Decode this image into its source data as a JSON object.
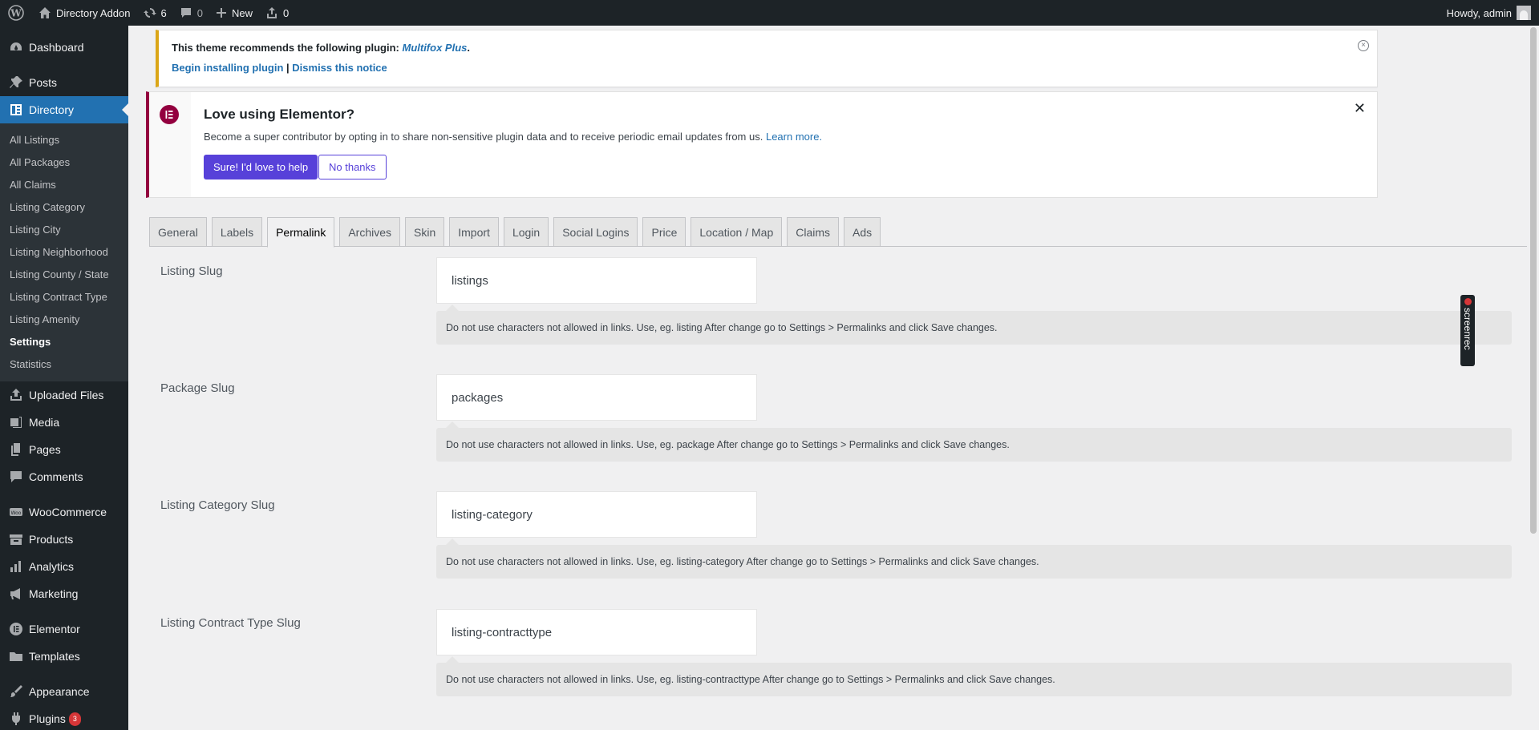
{
  "adminbar": {
    "site_name": "Directory Addon",
    "updates_count": "6",
    "comments_count": "0",
    "new_label": "New",
    "uploads_count": "0",
    "howdy": "Howdy, admin"
  },
  "sidebar": {
    "dashboard": "Dashboard",
    "posts": "Posts",
    "directory": "Directory",
    "submenu": [
      "All Listings",
      "All Packages",
      "All Claims",
      "Listing Category",
      "Listing City",
      "Listing Neighborhood",
      "Listing County / State",
      "Listing Contract Type",
      "Listing Amenity",
      "Settings",
      "Statistics"
    ],
    "uploaded_files": "Uploaded Files",
    "media": "Media",
    "pages": "Pages",
    "comments": "Comments",
    "woocommerce": "WooCommerce",
    "products": "Products",
    "analytics": "Analytics",
    "marketing": "Marketing",
    "elementor": "Elementor",
    "templates": "Templates",
    "appearance": "Appearance",
    "plugins": "Plugins",
    "plugins_badge": "3"
  },
  "notice_tgm": {
    "text": "This theme recommends the following plugin:",
    "plugin": "Multifox Plus",
    "period": ".",
    "begin": "Begin installing plugin",
    "divider": "|",
    "dismiss": "Dismiss this notice"
  },
  "notice_elementor": {
    "title": "Love using Elementor?",
    "text": "Become a super contributor by opting in to share non-sensitive plugin data and to receive periodic email updates from us.",
    "learn_more": "Learn more.",
    "yes": "Sure! I'd love to help",
    "no": "No thanks"
  },
  "tabs": [
    "General",
    "Labels",
    "Permalink",
    "Archives",
    "Skin",
    "Import",
    "Login",
    "Social Logins",
    "Price",
    "Location / Map",
    "Claims",
    "Ads"
  ],
  "active_tab": "Permalink",
  "fields": [
    {
      "label": "Listing Slug",
      "value": "listings",
      "desc": "Do not use characters not allowed in links. Use, eg. listing After change go to Settings > Permalinks and click Save changes."
    },
    {
      "label": "Package Slug",
      "value": "packages",
      "desc": "Do not use characters not allowed in links. Use, eg. package After change go to Settings > Permalinks and click Save changes."
    },
    {
      "label": "Listing Category Slug",
      "value": "listing-category",
      "desc": "Do not use characters not allowed in links. Use, eg. listing-category After change go to Settings > Permalinks and click Save changes."
    },
    {
      "label": "Listing Contract Type Slug",
      "value": "listing-contracttype",
      "desc": "Do not use characters not allowed in links. Use, eg. listing-contracttype After change go to Settings > Permalinks and click Save changes."
    }
  ],
  "screenrec": "screenrec"
}
